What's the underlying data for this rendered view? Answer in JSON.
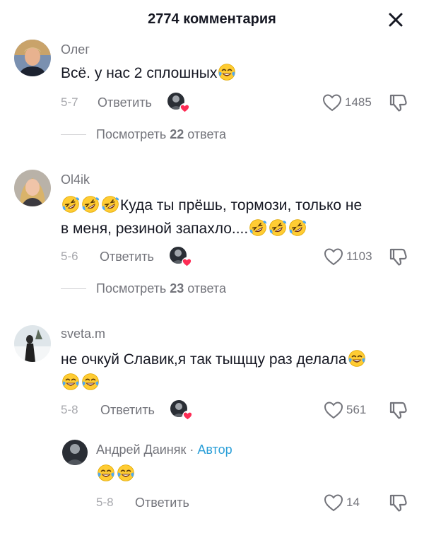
{
  "header": {
    "title": "2774 комментария"
  },
  "comments": [
    {
      "username": "Олег",
      "text": "Всё. у нас 2 сплошных",
      "date": "5-7",
      "reply_label": "Ответить",
      "likes": "1485",
      "view_replies_prefix": "Посмотреть ",
      "view_replies_count": "22",
      "view_replies_suffix": " ответа"
    },
    {
      "username": "Ol4ik",
      "text_line1": "Куда ты прёшь, тормози, только не",
      "text_line2": "в меня, резиной запахло....",
      "date": "5-6",
      "reply_label": "Ответить",
      "likes": "1103",
      "view_replies_prefix": "Посмотреть ",
      "view_replies_count": "23",
      "view_replies_suffix": " ответа"
    },
    {
      "username": "sveta.m",
      "text": "не очкуй Славик,я так тыщщу раз делала",
      "date": "5-8",
      "reply_label": "Ответить",
      "likes": "561"
    }
  ],
  "reply": {
    "username": "Андрей Даиняк",
    "separator": " · ",
    "author_label": "Автор",
    "date": "5-8",
    "reply_label": "Ответить",
    "likes": "14"
  },
  "icons": {
    "close": "close-icon",
    "like": "heart-outline-icon",
    "dislike": "thumbs-down-icon",
    "laugh": "tears-of-joy-emoji",
    "rofl": "rolling-laughing-emoji"
  },
  "colors": {
    "accent_author": "#2b9fd8",
    "liked_heart": "#fe2c55"
  }
}
